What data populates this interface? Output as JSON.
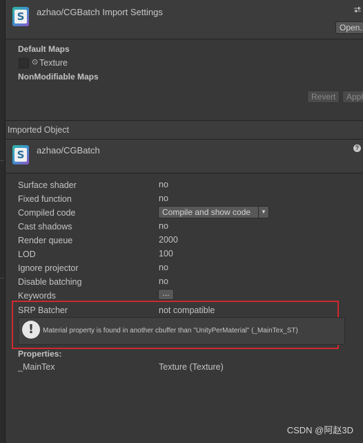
{
  "header": {
    "title": "azhao/CGBatch Import Settings",
    "open_label": "Open.",
    "settings_icon": "sliders-icon"
  },
  "maps": {
    "default_heading": "Default Maps",
    "texture_label": "Texture",
    "nonmodifiable_heading": "NonModifiable Maps",
    "revert_label": "Revert",
    "apply_label": "Appl"
  },
  "imported": {
    "section_title": "Imported Object",
    "object_name": "azhao/CGBatch",
    "help_glyph": "?"
  },
  "props": [
    {
      "label": "Surface shader",
      "value": "no"
    },
    {
      "label": "Fixed function",
      "value": "no"
    },
    {
      "label": "Compiled code",
      "value": "Compile and show code"
    },
    {
      "label": "Cast shadows",
      "value": "no"
    },
    {
      "label": "Render queue",
      "value": "2000"
    },
    {
      "label": "LOD",
      "value": "100"
    },
    {
      "label": "Ignore projector",
      "value": "no"
    },
    {
      "label": "Disable batching",
      "value": "no"
    },
    {
      "label": "Keywords",
      "value": "..."
    }
  ],
  "srp": {
    "label": "SRP Batcher",
    "value": "not compatible",
    "message": "Material property is found in another cbuffer than \"UnityPerMaterial\" (_MainTex_ST)"
  },
  "properties": {
    "heading": "Properties:",
    "items": [
      {
        "name": "_MainTex",
        "value": "Texture (Texture)"
      }
    ]
  },
  "watermark": "CSDN @阿赵3D",
  "colors": {
    "highlight_border": "#d0282e",
    "background": "#383838"
  }
}
